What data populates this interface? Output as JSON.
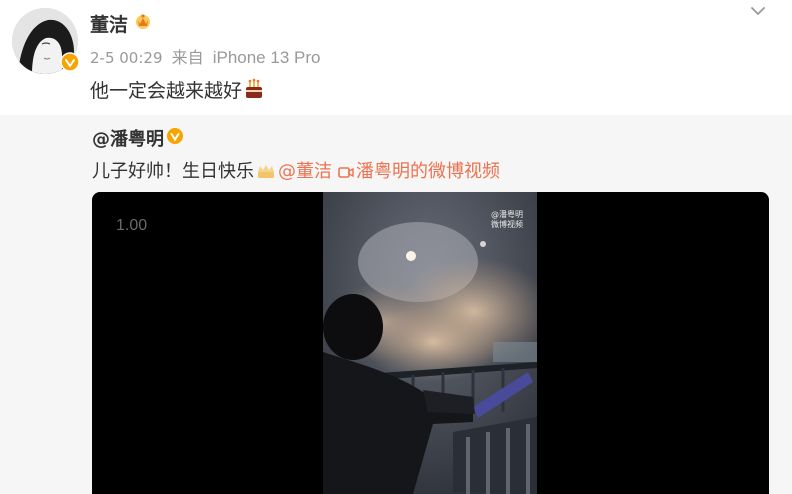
{
  "post": {
    "author": "董洁",
    "date": "2-5 00:29",
    "source_prefix": "来自",
    "device": "iPhone 13 Pro",
    "text": "他一定会越来越好",
    "icons": [
      "avatar",
      "verified-badge-icon",
      "crown-badge-icon",
      "chevron-down-icon",
      "birthday-cake-icon"
    ]
  },
  "repost": {
    "author": "@潘粤明",
    "text_plain": "儿子好帅！生日快乐",
    "mention": "@董洁",
    "video_link": "潘粤明的微博视频",
    "icons": [
      "verified-badge-icon",
      "crown-icon",
      "video-camera-icon"
    ]
  },
  "video": {
    "speed": "1.00",
    "watermark_line1": "@潘粤明",
    "watermark_line2": "微博视频"
  },
  "colors": {
    "link": "#eb7350",
    "verified": "#f7a300",
    "repost_bg": "#f6f6f6",
    "meta_text": "#999999"
  }
}
